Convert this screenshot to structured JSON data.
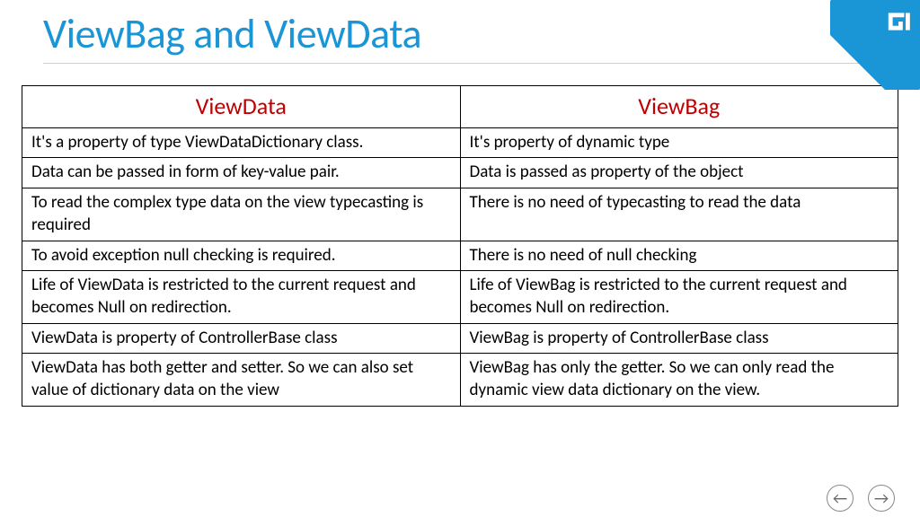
{
  "title": "ViewBag and ViewData",
  "tableHeaders": {
    "col1": "ViewData",
    "col2": "ViewBag"
  },
  "rows": [
    {
      "c1": "It's a property of type ViewDataDictionary class.",
      "c2": "It's property of dynamic type"
    },
    {
      "c1": "Data can be passed in form of key-value pair.",
      "c2": "Data is passed as property of the object"
    },
    {
      "c1": "To read the complex type data on the view typecasting is required",
      "c2": "There is no need of typecasting to read the data"
    },
    {
      "c1": "To avoid exception null checking is required.",
      "c2": "There is no need of null checking"
    },
    {
      "c1": "Life of ViewData is restricted to the current request and becomes Null on redirection.",
      "c2": "Life of ViewBag is restricted to the current request and becomes Null on redirection."
    },
    {
      "c1": "ViewData is property of ControllerBase class",
      "c2": "ViewBag is property of ControllerBase class"
    },
    {
      "c1": "ViewData has both getter and setter. So we can also set value of dictionary data on the view",
      "c2": "ViewBag has only the getter. So we can only read the dynamic view data dictionary on the view."
    }
  ],
  "nav": {
    "prev": "←",
    "next": "→"
  }
}
